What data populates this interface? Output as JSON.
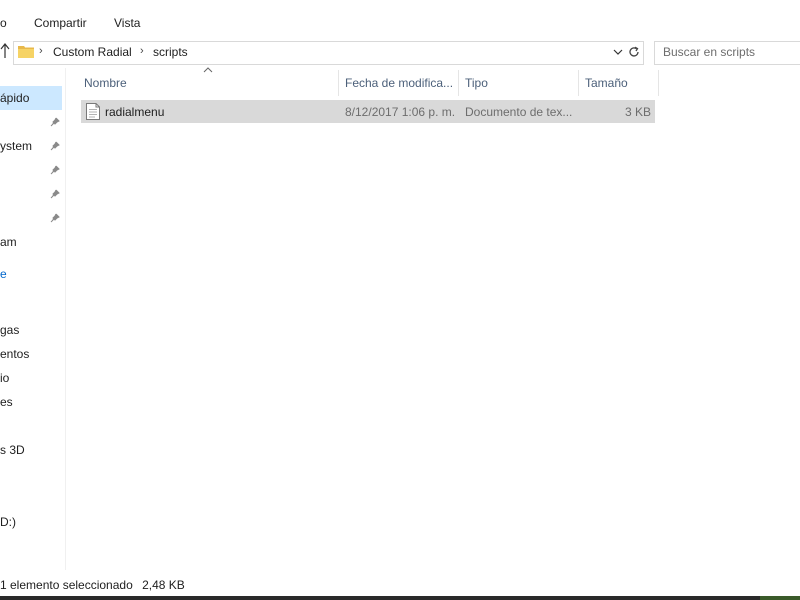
{
  "ribbon": {
    "tabs": [
      {
        "label": "o"
      },
      {
        "label": "Compartir"
      },
      {
        "label": "Vista"
      }
    ]
  },
  "address": {
    "crumbs": [
      "Custom Radial",
      "scripts"
    ],
    "search_placeholder": "Buscar en scripts"
  },
  "nav": {
    "items": [
      {
        "label": "ápido",
        "selected": true,
        "pinned": false
      },
      {
        "label": "",
        "pinned": true
      },
      {
        "label": "ystem",
        "pinned": true
      },
      {
        "label": "",
        "pinned": true
      },
      {
        "label": "",
        "pinned": true
      },
      {
        "label": "",
        "pinned": true
      },
      {
        "label": "am"
      },
      {
        "label": "e"
      },
      {
        "label": "gas"
      },
      {
        "label": "entos"
      },
      {
        "label": "io"
      },
      {
        "label": "es"
      },
      {
        "label": "s 3D"
      },
      {
        "label": "D:)"
      }
    ]
  },
  "columns": {
    "name": "Nombre",
    "date": "Fecha de modifica...",
    "type": "Tipo",
    "size": "Tamaño"
  },
  "files": [
    {
      "name": "radialmenu",
      "date": "8/12/2017 1:06 p. m.",
      "type": "Documento de tex...",
      "size": "3 KB",
      "icon": "text-file-icon",
      "selected": true
    }
  ],
  "status": {
    "count": "1 elemento seleccionado",
    "size": "2,48 KB"
  },
  "colors": {
    "selection": "#d9d9d9",
    "nav_selection": "#cce8ff",
    "header_text": "#4c607a"
  }
}
